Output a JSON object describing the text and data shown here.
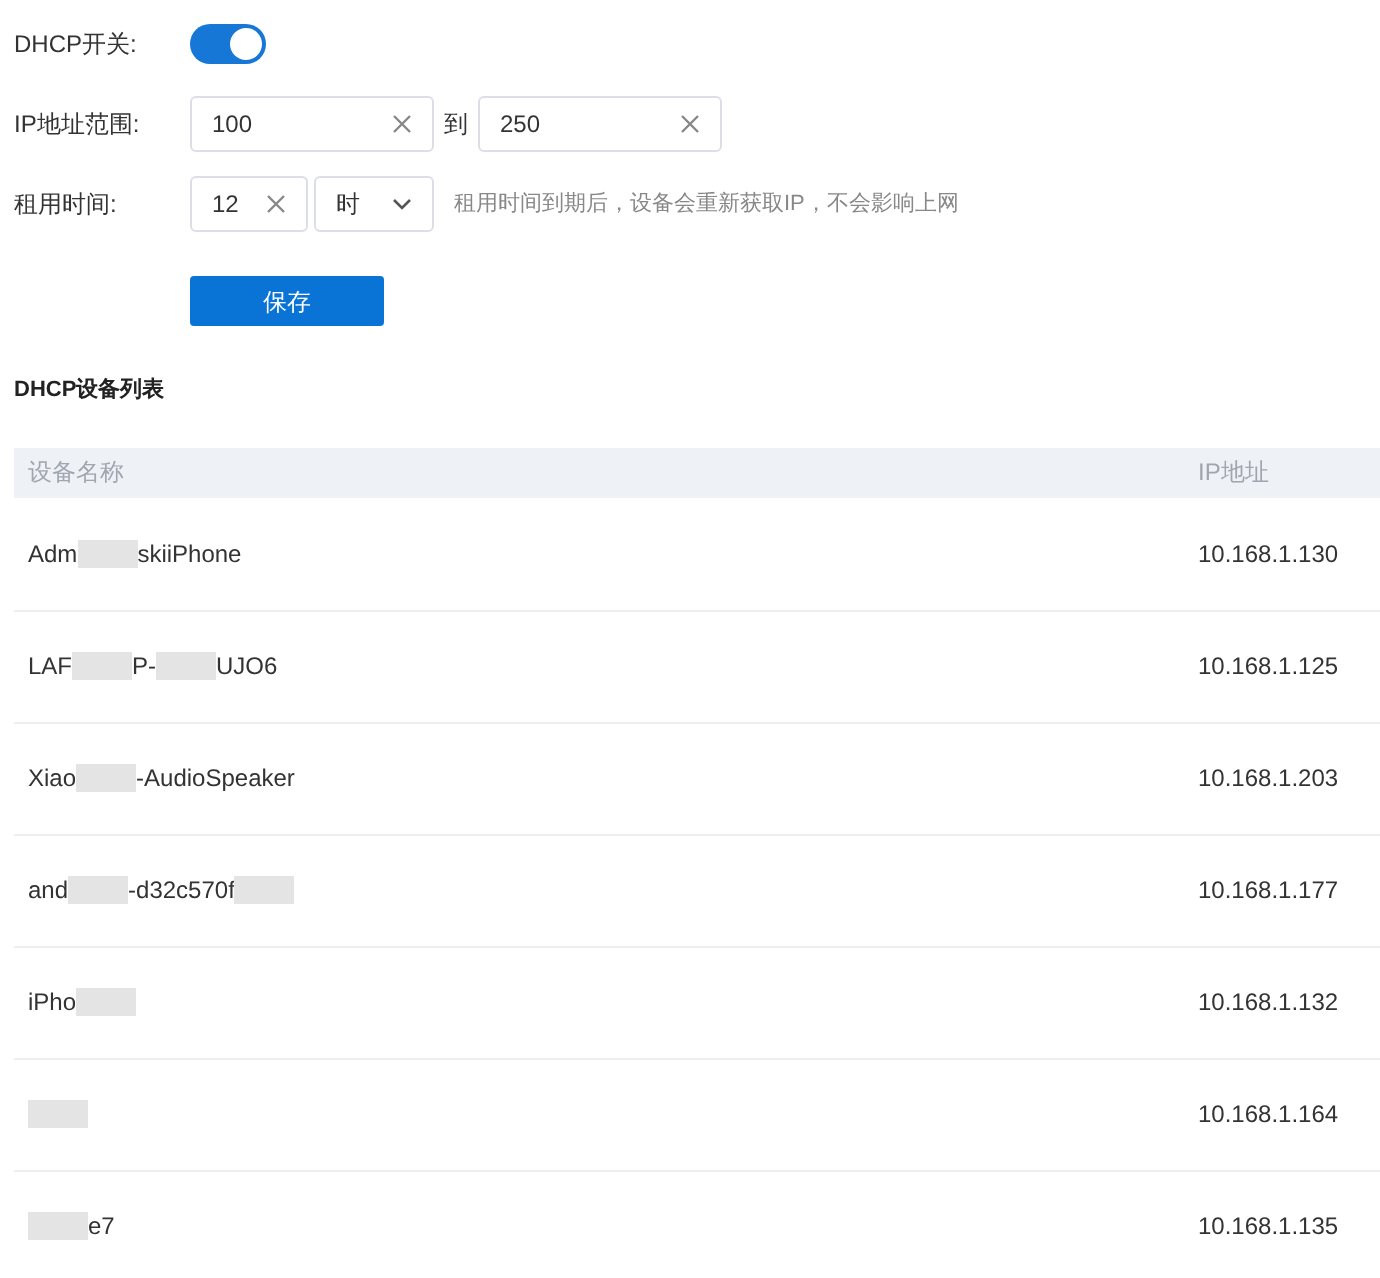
{
  "form": {
    "dhcp_label": "DHCP开关:",
    "dhcp_on": true,
    "range_label": "IP地址范围:",
    "range_start": "100",
    "range_to": "到",
    "range_end": "250",
    "lease_label": "租用时间:",
    "lease_value": "12",
    "lease_unit": "时",
    "lease_hint": "租用时间到期后，设备会重新获取IP，不会影响上网",
    "save": "保存"
  },
  "list_title": "DHCP设备列表",
  "table": {
    "columns": [
      "设备名称",
      "IP地址"
    ],
    "rows": [
      {
        "name": [
          {
            "kind": "text",
            "text": "Adm"
          },
          {
            "kind": "redacted"
          },
          {
            "kind": "text",
            "text": "skiiPhone"
          }
        ],
        "ip": "10.168.1.130"
      },
      {
        "name": [
          {
            "kind": "text",
            "text": "LAF"
          },
          {
            "kind": "redacted"
          },
          {
            "kind": "text",
            "text": "P-"
          },
          {
            "kind": "redacted"
          },
          {
            "kind": "text",
            "text": "UJO6"
          }
        ],
        "ip": "10.168.1.125"
      },
      {
        "name": [
          {
            "kind": "text",
            "text": "Xiao"
          },
          {
            "kind": "redacted"
          },
          {
            "kind": "text",
            "text": "-AudioSpeaker"
          }
        ],
        "ip": "10.168.1.203"
      },
      {
        "name": [
          {
            "kind": "text",
            "text": "and"
          },
          {
            "kind": "redacted"
          },
          {
            "kind": "text",
            "text": "-d32c570f"
          },
          {
            "kind": "redacted"
          }
        ],
        "ip": "10.168.1.177"
      },
      {
        "name": [
          {
            "kind": "text",
            "text": "iPho"
          },
          {
            "kind": "redacted"
          }
        ],
        "ip": "10.168.1.132"
      },
      {
        "name": [
          {
            "kind": "redacted"
          }
        ],
        "ip": "10.168.1.164"
      },
      {
        "name": [
          {
            "kind": "redacted"
          },
          {
            "kind": "text",
            "text": "e7"
          }
        ],
        "ip": "10.168.1.135"
      }
    ]
  }
}
